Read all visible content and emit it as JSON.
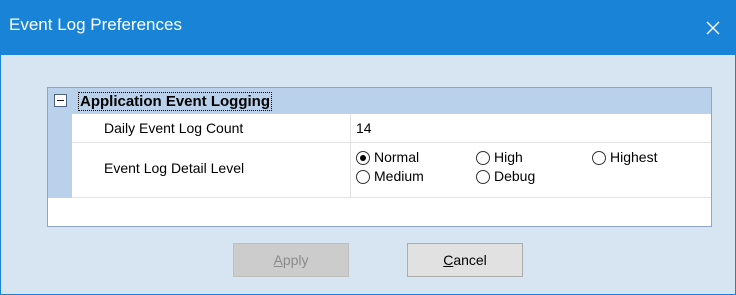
{
  "window": {
    "title": "Event Log Preferences",
    "close_icon": "close-icon"
  },
  "group": {
    "title": "Application Event Logging",
    "collapse_icon": "collapse-minus-icon",
    "expanded": true
  },
  "rows": [
    {
      "label": "Daily Event Log Count",
      "value": "14"
    },
    {
      "label": "Event Log Detail Level"
    }
  ],
  "detail_level_options": [
    {
      "label": "Normal",
      "selected": true
    },
    {
      "label": "High",
      "selected": false
    },
    {
      "label": "Highest",
      "selected": false
    },
    {
      "label": "Medium",
      "selected": false
    },
    {
      "label": "Debug",
      "selected": false
    }
  ],
  "buttons": {
    "apply": {
      "mnemonic": "A",
      "rest": "pply",
      "enabled": false
    },
    "cancel": {
      "mnemonic": "C",
      "rest": "ancel",
      "enabled": true
    }
  },
  "colors": {
    "titlebar": "#1883d7",
    "window_bg": "#d7e4f2",
    "group_header": "#b9d1ea"
  }
}
